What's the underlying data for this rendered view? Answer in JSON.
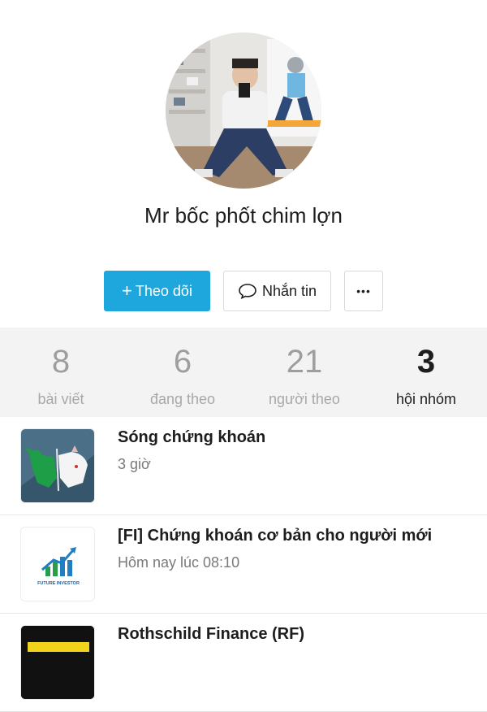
{
  "profile": {
    "name": "Mr bốc phốt chim lợn"
  },
  "actions": {
    "follow_plus": "+",
    "follow_label": "Theo dõi",
    "message_label": "Nhắn tin",
    "more_label": "•••"
  },
  "stats": [
    {
      "count": "8",
      "label": "bài viết"
    },
    {
      "count": "6",
      "label": "đang theo"
    },
    {
      "count": "21",
      "label": "người theo"
    },
    {
      "count": "3",
      "label": "hội nhóm"
    }
  ],
  "groups": [
    {
      "title": "Sóng chứng khoán",
      "time": "3 giờ"
    },
    {
      "title": "[FI] Chứng khoán cơ bản cho người mới",
      "time": "Hôm nay lúc 08:10",
      "logo_text": "FUTURE INVESTOR"
    },
    {
      "title": "Rothschild Finance (RF)",
      "time": ""
    }
  ],
  "colors": {
    "accent": "#1ea7dd",
    "stats_bg": "#f3f3f3",
    "muted_text": "#9e9e9e"
  }
}
